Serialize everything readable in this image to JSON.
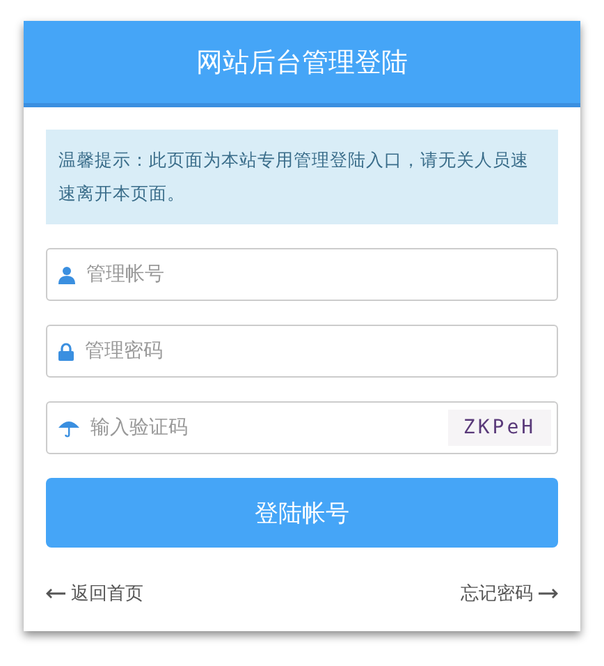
{
  "header": {
    "title": "网站后台管理登陆"
  },
  "notice": "温馨提示：此页面为本站专用管理登陆入口，请无关人员速速离开本页面。",
  "fields": [
    {
      "kind": "user",
      "placeholder": "管理帐号"
    },
    {
      "kind": "lock",
      "placeholder": "管理密码"
    },
    {
      "kind": "umbrella",
      "placeholder": "输入验证码",
      "captcha": "ZKPeH"
    }
  ],
  "submit": "登陆帐号",
  "links": [
    {
      "label": "返回首页",
      "kind": "back"
    },
    {
      "label": "忘记密码",
      "kind": "forward"
    }
  ]
}
